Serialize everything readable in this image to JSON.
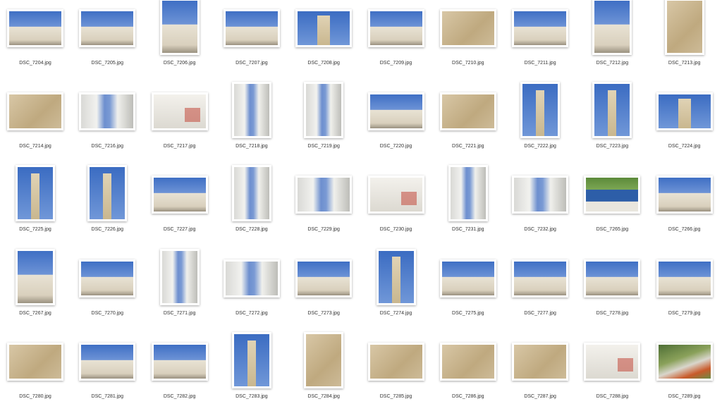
{
  "window": {
    "view": "icon-view"
  },
  "files": [
    {
      "name": "DSC_7204.jpg",
      "orientation": "landscape",
      "tone": "sky"
    },
    {
      "name": "DSC_7205.jpg",
      "orientation": "landscape",
      "tone": "sky"
    },
    {
      "name": "DSC_7206.jpg",
      "orientation": "portrait",
      "tone": "sky"
    },
    {
      "name": "DSC_7207.jpg",
      "orientation": "landscape",
      "tone": "sky"
    },
    {
      "name": "DSC_7208.jpg",
      "orientation": "landscape",
      "tone": "tower"
    },
    {
      "name": "DSC_7209.jpg",
      "orientation": "landscape",
      "tone": "sky"
    },
    {
      "name": "DSC_7210.jpg",
      "orientation": "landscape",
      "tone": "stone"
    },
    {
      "name": "DSC_7211.jpg",
      "orientation": "landscape",
      "tone": "sky"
    },
    {
      "name": "DSC_7212.jpg",
      "orientation": "portrait",
      "tone": "sky"
    },
    {
      "name": "DSC_7213.jpg",
      "orientation": "portrait",
      "tone": "stone"
    },
    {
      "name": "DSC_7214.jpg",
      "orientation": "landscape",
      "tone": "stone"
    },
    {
      "name": "DSC_7216.jpg",
      "orientation": "landscape",
      "tone": "alley"
    },
    {
      "name": "DSC_7217.jpg",
      "orientation": "landscape",
      "tone": "white"
    },
    {
      "name": "DSC_7218.jpg",
      "orientation": "portrait",
      "tone": "alley"
    },
    {
      "name": "DSC_7219.jpg",
      "orientation": "portrait",
      "tone": "alley"
    },
    {
      "name": "DSC_7220.jpg",
      "orientation": "landscape",
      "tone": "sky"
    },
    {
      "name": "DSC_7221.jpg",
      "orientation": "landscape",
      "tone": "stone"
    },
    {
      "name": "DSC_7222.jpg",
      "orientation": "portrait",
      "tone": "tower"
    },
    {
      "name": "DSC_7223.jpg",
      "orientation": "portrait",
      "tone": "tower"
    },
    {
      "name": "DSC_7224.jpg",
      "orientation": "landscape",
      "tone": "tower"
    },
    {
      "name": "DSC_7225.jpg",
      "orientation": "portrait",
      "tone": "tower"
    },
    {
      "name": "DSC_7226.jpg",
      "orientation": "portrait",
      "tone": "tower"
    },
    {
      "name": "DSC_7227.jpg",
      "orientation": "landscape",
      "tone": "sky"
    },
    {
      "name": "DSC_7228.jpg",
      "orientation": "portrait",
      "tone": "alley"
    },
    {
      "name": "DSC_7229.jpg",
      "orientation": "landscape",
      "tone": "alley"
    },
    {
      "name": "DSC_7230.jpg",
      "orientation": "landscape",
      "tone": "white"
    },
    {
      "name": "DSC_7231.jpg",
      "orientation": "portrait",
      "tone": "alley"
    },
    {
      "name": "DSC_7232.jpg",
      "orientation": "landscape",
      "tone": "alley"
    },
    {
      "name": "DSC_7265.jpg",
      "orientation": "landscape",
      "tone": "sign"
    },
    {
      "name": "DSC_7266.jpg",
      "orientation": "landscape",
      "tone": "sky"
    },
    {
      "name": "DSC_7267.jpg",
      "orientation": "portrait",
      "tone": "sky"
    },
    {
      "name": "DSC_7270.jpg",
      "orientation": "landscape",
      "tone": "sky"
    },
    {
      "name": "DSC_7271.jpg",
      "orientation": "portrait",
      "tone": "alley"
    },
    {
      "name": "DSC_7272.jpg",
      "orientation": "landscape",
      "tone": "alley"
    },
    {
      "name": "DSC_7273.jpg",
      "orientation": "landscape",
      "tone": "sky"
    },
    {
      "name": "DSC_7274.jpg",
      "orientation": "portrait",
      "tone": "tower"
    },
    {
      "name": "DSC_7275.jpg",
      "orientation": "landscape",
      "tone": "sky"
    },
    {
      "name": "DSC_7277.jpg",
      "orientation": "landscape",
      "tone": "sky"
    },
    {
      "name": "DSC_7278.jpg",
      "orientation": "landscape",
      "tone": "sky"
    },
    {
      "name": "DSC_7279.jpg",
      "orientation": "landscape",
      "tone": "sky"
    },
    {
      "name": "DSC_7280.jpg",
      "orientation": "landscape",
      "tone": "stone"
    },
    {
      "name": "DSC_7281.jpg",
      "orientation": "landscape",
      "tone": "sky"
    },
    {
      "name": "DSC_7282.jpg",
      "orientation": "landscape",
      "tone": "sky"
    },
    {
      "name": "DSC_7283.jpg",
      "orientation": "portrait",
      "tone": "tower"
    },
    {
      "name": "DSC_7284.jpg",
      "orientation": "portrait",
      "tone": "stone"
    },
    {
      "name": "DSC_7285.jpg",
      "orientation": "landscape",
      "tone": "stone"
    },
    {
      "name": "DSC_7286.jpg",
      "orientation": "landscape",
      "tone": "stone"
    },
    {
      "name": "DSC_7287.jpg",
      "orientation": "landscape",
      "tone": "stone"
    },
    {
      "name": "DSC_7288.jpg",
      "orientation": "landscape",
      "tone": "white"
    },
    {
      "name": "DSC_7289.jpg",
      "orientation": "landscape",
      "tone": "green"
    }
  ]
}
